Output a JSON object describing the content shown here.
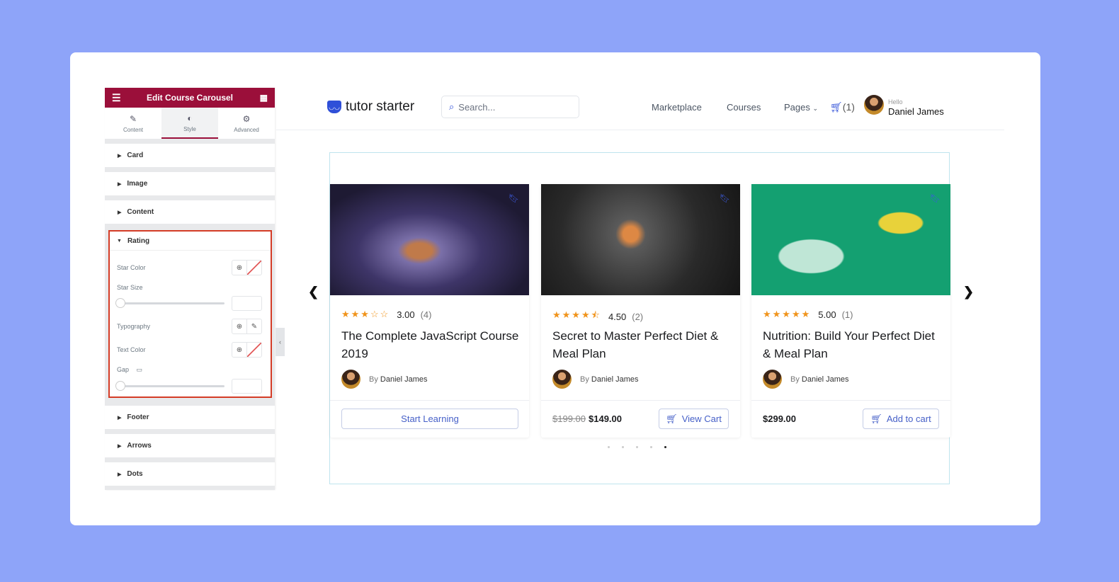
{
  "editor": {
    "title": "Edit Course Carousel",
    "tabs": [
      {
        "label": "Content",
        "icon": "pencil-icon"
      },
      {
        "label": "Style",
        "icon": "contrast-icon"
      },
      {
        "label": "Advanced",
        "icon": "gear-icon"
      }
    ],
    "sections": [
      "Card",
      "Image",
      "Content",
      "Footer",
      "Arrows",
      "Dots"
    ],
    "rating": {
      "title": "Rating",
      "star_color": "Star Color",
      "star_size": "Star Size",
      "typography": "Typography",
      "text_color": "Text Color",
      "gap": "Gap"
    }
  },
  "site": {
    "logo": "tutor starter",
    "search_placeholder": "Search...",
    "nav": [
      "Marketplace",
      "Courses",
      "Pages"
    ],
    "cart": "(1)",
    "hello": "Hello",
    "user": "Daniel James"
  },
  "courses": [
    {
      "title": "The Complete JavaScript Course 2019",
      "rating": "3.00",
      "count": "(4)",
      "stars": 3,
      "by": "By",
      "author": "Daniel James",
      "button": "Start Learning"
    },
    {
      "title": "Secret to Master Perfect Diet & Meal Plan",
      "rating": "4.50",
      "count": "(2)",
      "stars": 4.5,
      "by": "By",
      "author": "Daniel James",
      "old_price": "$199.00",
      "price": "$149.00",
      "button": "View Cart"
    },
    {
      "title": "Nutrition: Build Your Perfect Diet & Meal Plan",
      "rating": "5.00",
      "count": "(1)",
      "stars": 5,
      "by": "By",
      "author": "Daniel James",
      "price": "$299.00",
      "button": "Add to cart"
    }
  ],
  "carousel": {
    "dots": 5,
    "active_dot": 5
  },
  "colors": {
    "background": "#8ea4f9",
    "editor_accent": "#9b0f3a",
    "highlight": "#d43c26",
    "brand": "#2f4fd8",
    "star": "#f0941c"
  }
}
